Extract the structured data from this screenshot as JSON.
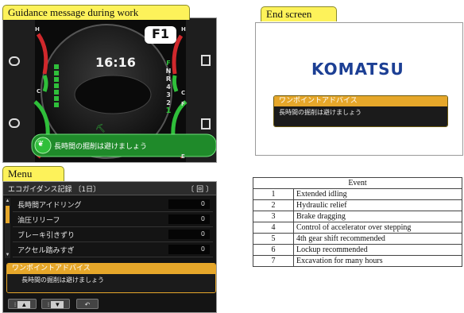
{
  "labels": {
    "guidance": "Guidance message during work",
    "end_screen": "End screen",
    "menu": "Menu"
  },
  "dashboard": {
    "mode": "F1",
    "time": "16:16",
    "gear_letters": [
      "F",
      "N",
      "R"
    ],
    "gear_numbers": [
      "4",
      "3",
      "2",
      "1"
    ],
    "gauge_letters": [
      "H",
      "C",
      "H",
      "C",
      "F",
      "E"
    ],
    "message": "長時間の掘削は避けましょう"
  },
  "end": {
    "logo": "KOMATSU",
    "advice_title": "ワンポイントアドバイス",
    "advice_text": "長時間の掘削は避けましょう"
  },
  "menu": {
    "title": "エコガイダンス記録 〔1日〕",
    "title_right": "〔 回 〕",
    "rows": [
      {
        "label": "長時間アイドリング",
        "value": "0"
      },
      {
        "label": "油圧リリーフ",
        "value": "0"
      },
      {
        "label": "ブレーキ引きずり",
        "value": "0"
      },
      {
        "label": "アクセル踏みすぎ",
        "value": "0"
      }
    ],
    "advice_title": "ワンポイントアドバイス",
    "advice_text": "長時間の掘削は避けましょう",
    "buttons": [
      "▲",
      "▼",
      "↶"
    ],
    "button_prefixes": [
      "⁝",
      "⁝"
    ]
  },
  "table": {
    "header": "Event",
    "rows": [
      {
        "n": "1",
        "event": "Extended idling"
      },
      {
        "n": "2",
        "event": "Hydraulic relief"
      },
      {
        "n": "3",
        "event": "Brake dragging"
      },
      {
        "n": "4",
        "event": "Control of accelerator over stepping"
      },
      {
        "n": "5",
        "event": "4th gear shift recommended"
      },
      {
        "n": "6",
        "event": "Lockup recommended"
      },
      {
        "n": "7",
        "event": "Excavation for many hours"
      }
    ]
  },
  "colors": {
    "label_yellow": "#fdf25a",
    "gauge_green": "#2fbf3a",
    "gauge_red": "#d0282c",
    "advice_orange": "#e6a72a",
    "logo_blue": "#1c3f94"
  },
  "icons": [
    "left-gauge-icon",
    "left-lower-gauge-icon",
    "fuel-icon",
    "gear-indicator-icon",
    "eco-leaf-icon",
    "operator-icon"
  ]
}
